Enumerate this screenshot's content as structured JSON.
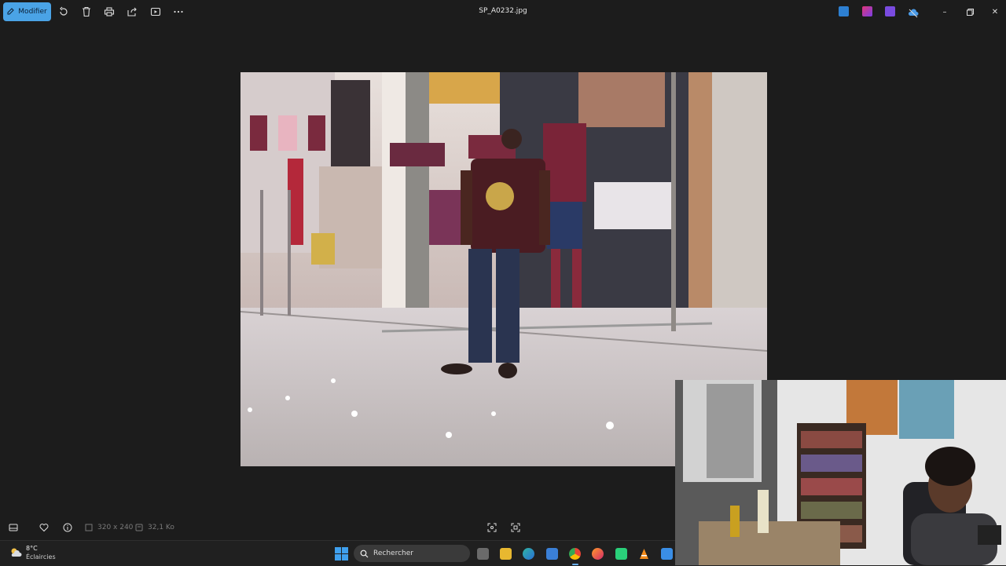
{
  "toolbar": {
    "modify_label": "Modifier",
    "file_title": "SP_A0232.jpg",
    "icons": [
      "edit-icon",
      "rotate-icon",
      "delete-icon",
      "print-icon",
      "share-icon",
      "slideshow-icon",
      "more-icon"
    ]
  },
  "infobar": {
    "dimensions": "320 x 240",
    "size": "32,1 Ko",
    "icons": [
      "filmstrip-icon",
      "favorite-icon",
      "info-icon",
      "dimensions-icon",
      "filesize-icon",
      "fit-icon",
      "actual-size-icon"
    ]
  },
  "taskbar": {
    "weather_temp": "8°C",
    "weather_desc": "Éclaircies",
    "search_placeholder": "Rechercher",
    "apps": [
      "task-view",
      "file-explorer",
      "edge",
      "store",
      "chrome",
      "firefox",
      "app-green",
      "vlc",
      "paint"
    ]
  },
  "colors": {
    "accent": "#4aa3e6",
    "background": "#1c1c1c",
    "taskbar": "#202020"
  }
}
